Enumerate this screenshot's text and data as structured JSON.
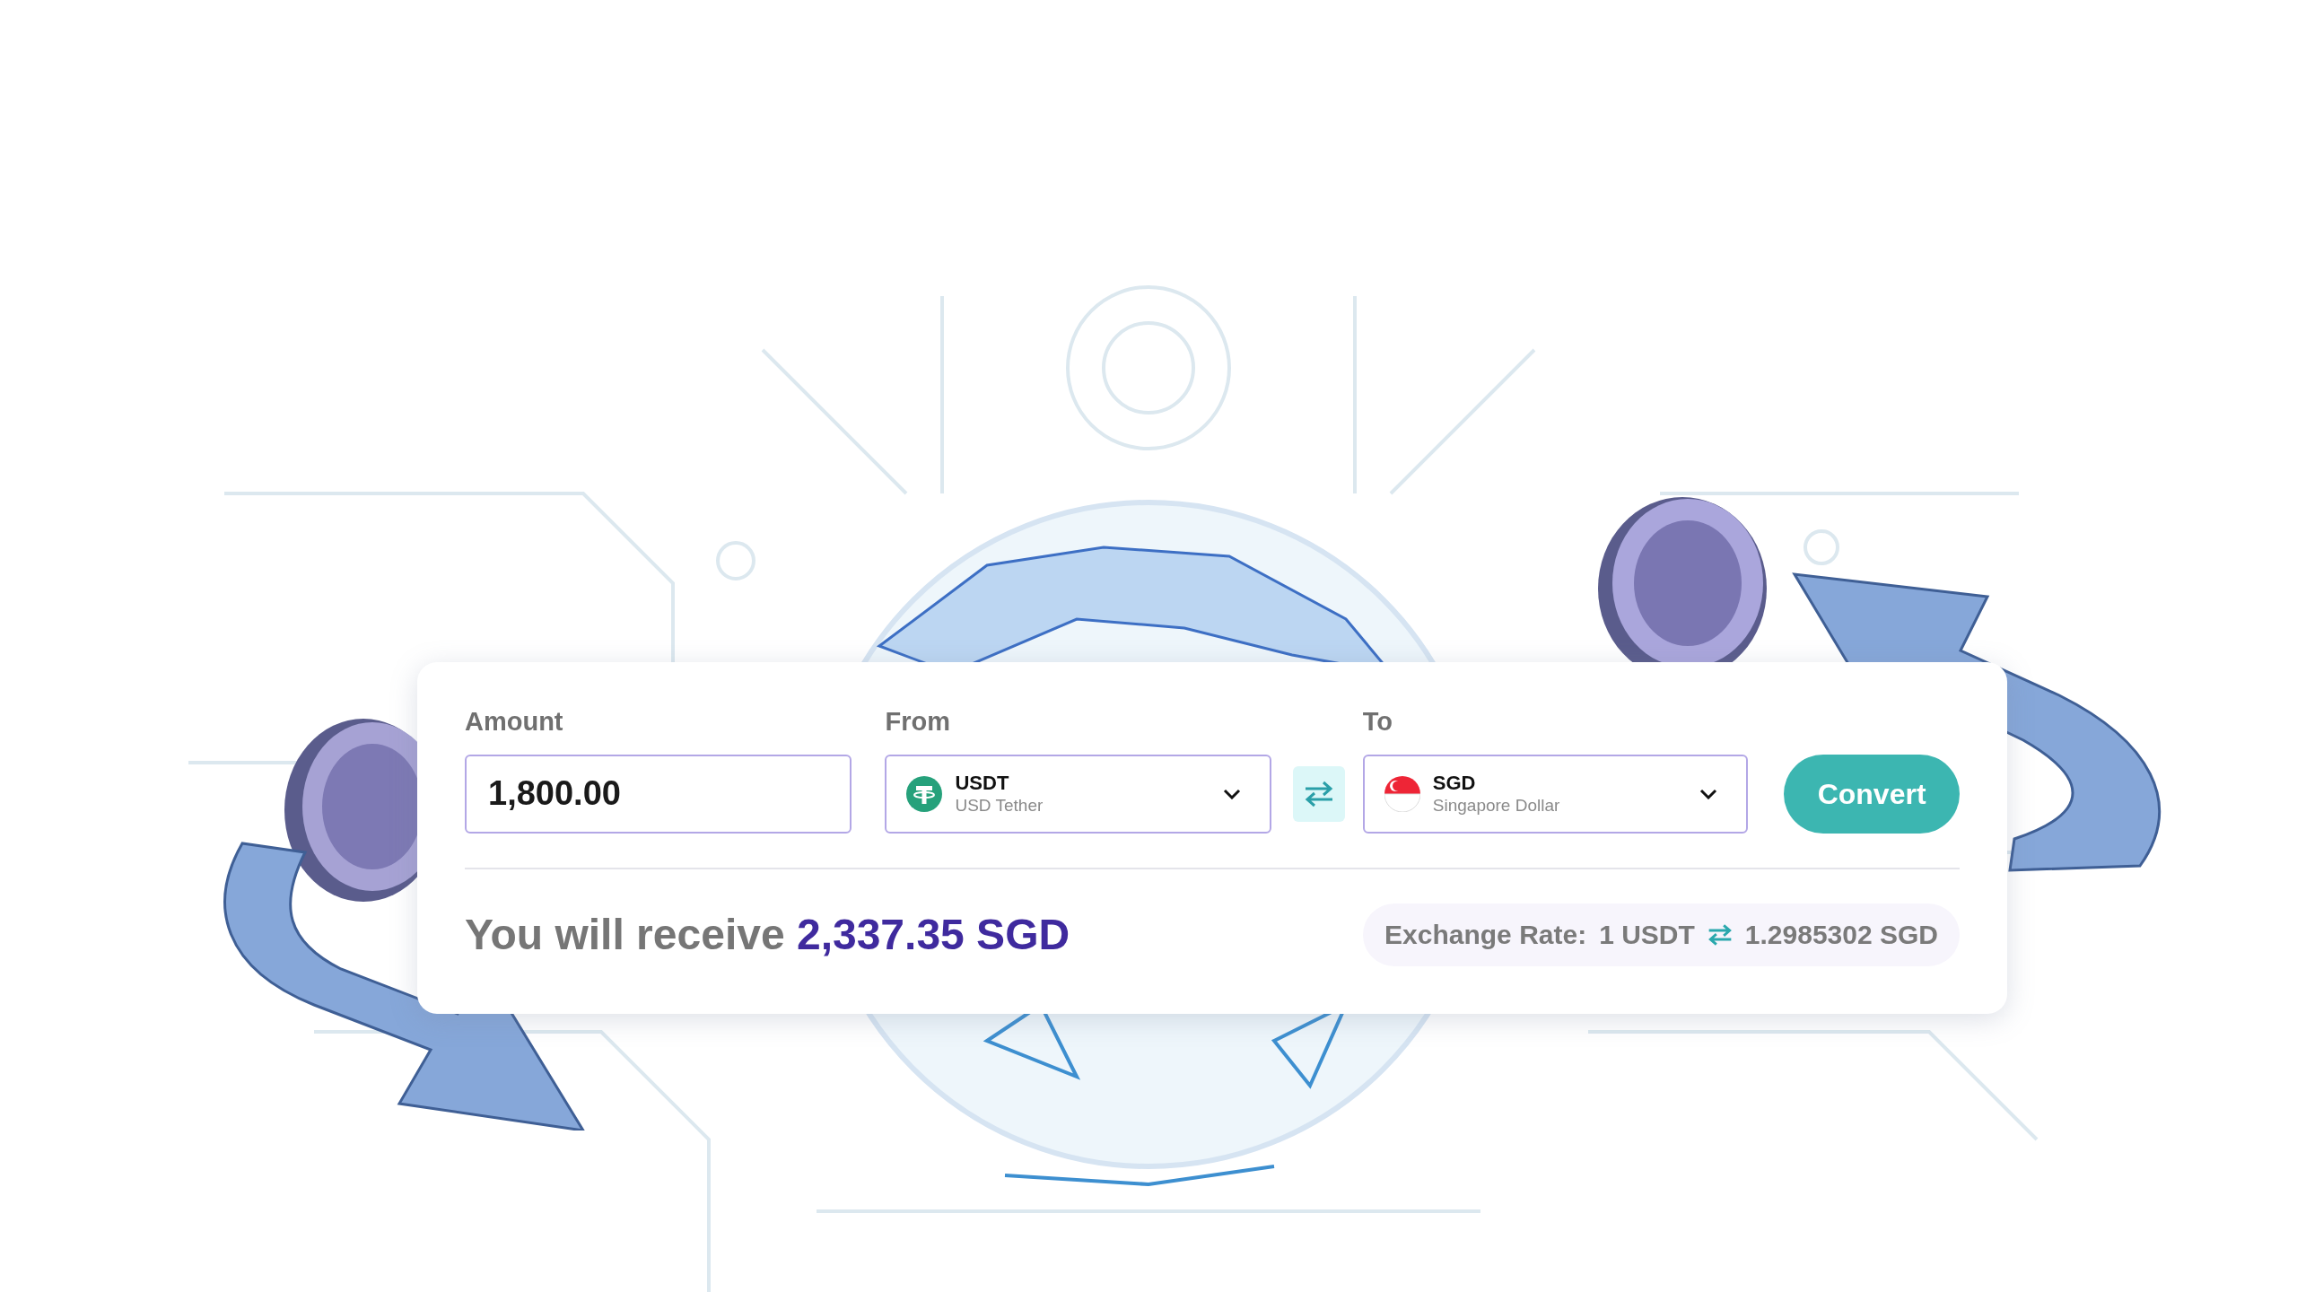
{
  "amount": {
    "label": "Amount",
    "value": "1,800.00"
  },
  "from": {
    "label": "From",
    "code": "USDT",
    "name": "USD Tether"
  },
  "to": {
    "label": "To",
    "code": "SGD",
    "name": "Singapore Dollar"
  },
  "convert_button": "Convert",
  "result": {
    "prefix": "You will receive",
    "amount": "2,337.35 SGD"
  },
  "exchange_rate": {
    "label": "Exchange Rate:",
    "from": "1 USDT",
    "to": "1.2985302 SGD"
  }
}
